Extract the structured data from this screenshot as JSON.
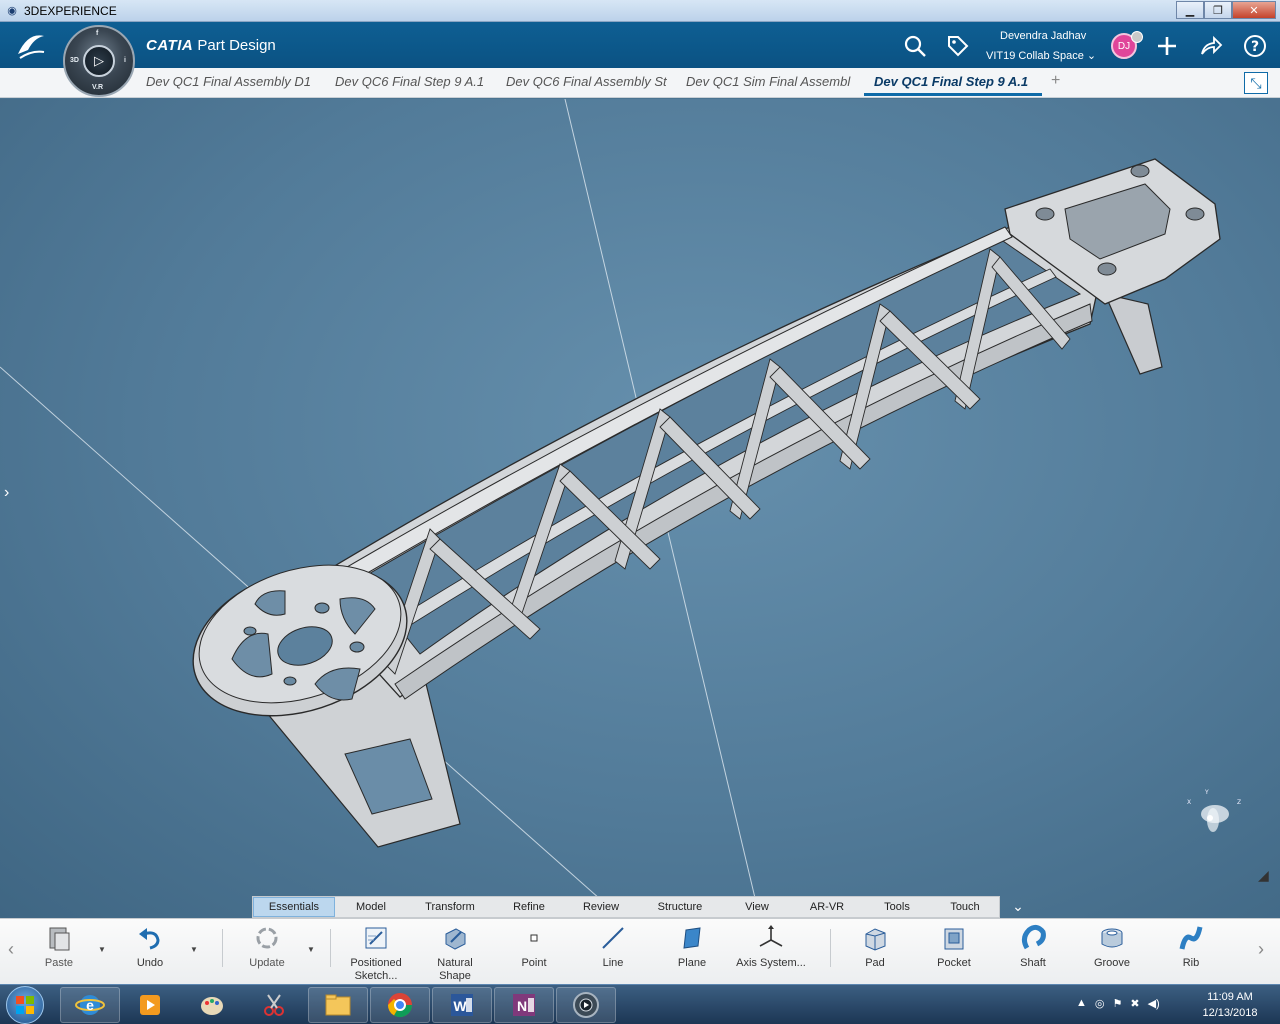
{
  "window": {
    "title": "3DEXPERIENCE"
  },
  "header": {
    "brand_a": "CATIA",
    "brand_b": "Part Design",
    "user_name": "Devendra Jadhav",
    "collab_space": "VIT19 Collab Space",
    "avatar_initials": "DJ",
    "compass_labels": {
      "left": "3D",
      "right": "i",
      "bottom": "V.R",
      "top": "f"
    }
  },
  "tabs": [
    {
      "label": "Dev QC1 Final Assembly D1",
      "active": false
    },
    {
      "label": "Dev QC6 Final Step 9 A.1",
      "active": false
    },
    {
      "label": "Dev QC6 Final Assembly St",
      "active": false
    },
    {
      "label": "Dev QC1 Sim Final Assembl",
      "active": false
    },
    {
      "label": "Dev QC1 Final Step 9 A.1",
      "active": true
    }
  ],
  "tab_add": "+",
  "action_tabs": [
    "Essentials",
    "Model",
    "Transform",
    "Refine",
    "Review",
    "Structure",
    "View",
    "AR-VR",
    "Tools",
    "Touch"
  ],
  "actions": {
    "paste": "Paste",
    "undo": "Undo",
    "update": "Update",
    "positioned_sketch": "Positioned Sketch...",
    "natural_shape": "Natural Shape",
    "point": "Point",
    "line": "Line",
    "plane": "Plane",
    "axis_system": "Axis System...",
    "pad": "Pad",
    "pocket": "Pocket",
    "shaft": "Shaft",
    "groove": "Groove",
    "rib": "Rib"
  },
  "taskbar": {
    "time": "11:09 AM",
    "date": "12/13/2018"
  },
  "colors": {
    "header_blue": "#0b5283",
    "viewport_blue": "#527b99",
    "active_tab": "#0f6ba8",
    "avatar": "#e0459a"
  }
}
